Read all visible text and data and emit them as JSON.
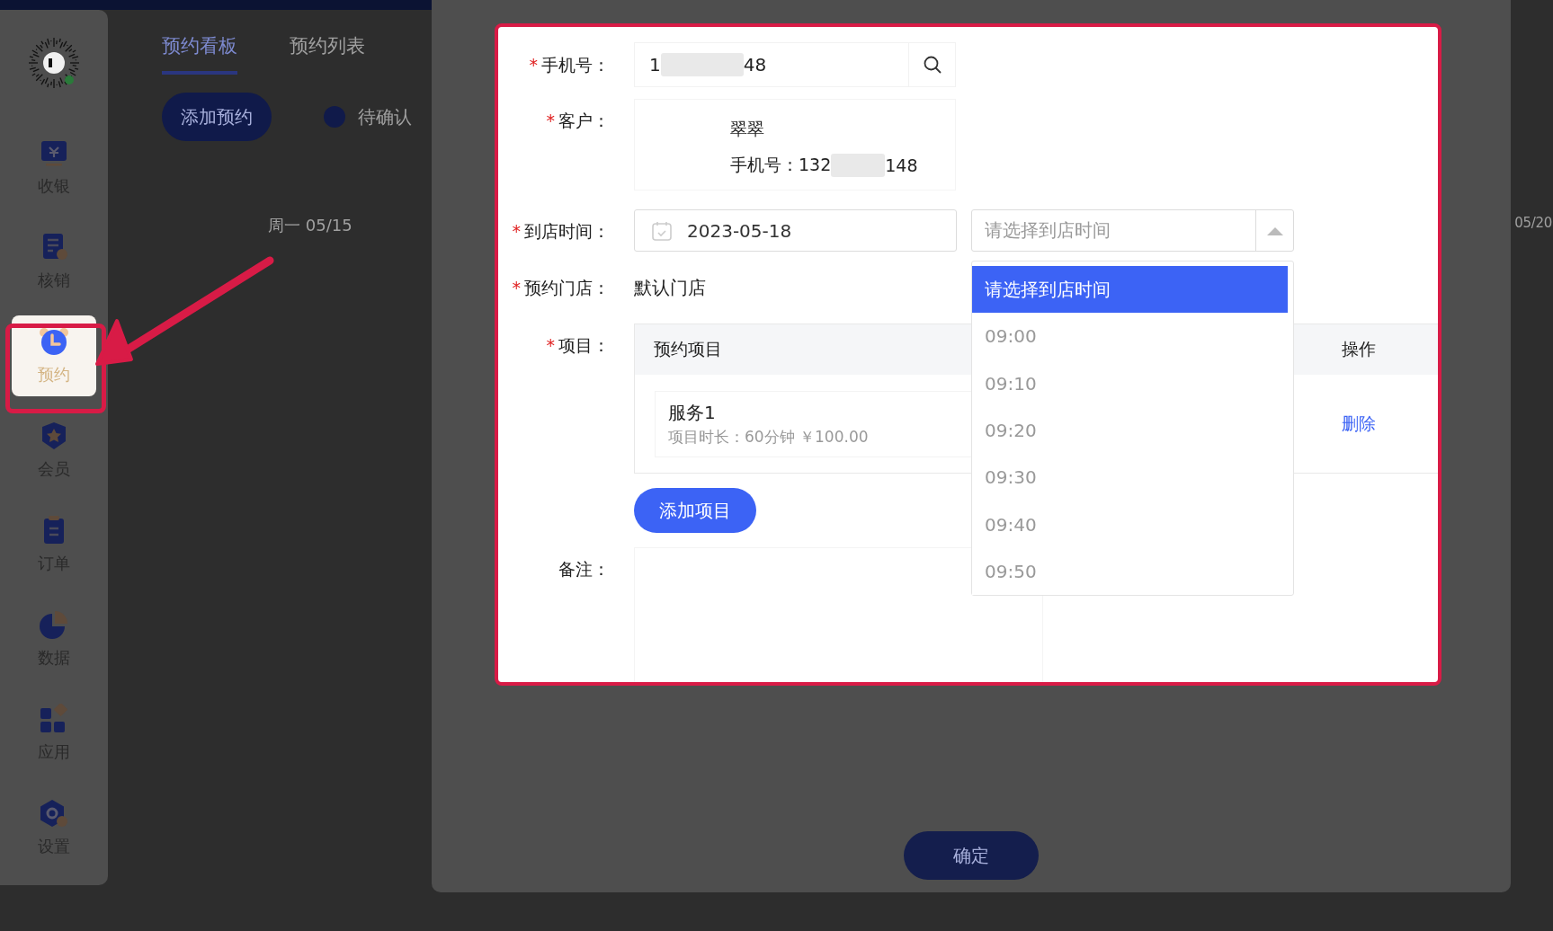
{
  "sidebar": {
    "items": [
      {
        "label": "收银",
        "kind": "cashier",
        "selected": false
      },
      {
        "label": "核销",
        "kind": "verify",
        "selected": false
      },
      {
        "label": "预约",
        "kind": "booking",
        "selected": true
      },
      {
        "label": "会员",
        "kind": "member",
        "selected": false
      },
      {
        "label": "订单",
        "kind": "order",
        "selected": false
      },
      {
        "label": "数据",
        "kind": "data",
        "selected": false
      },
      {
        "label": "应用",
        "kind": "apps",
        "selected": false
      },
      {
        "label": "设置",
        "kind": "settings",
        "selected": false
      }
    ]
  },
  "tabs": [
    {
      "label": "预约看板",
      "selected": true
    },
    {
      "label": "预约列表",
      "selected": false
    }
  ],
  "toolbar": {
    "add_button": "添加预约",
    "legend": [
      {
        "label": "待确认",
        "color": "#101a4a"
      }
    ]
  },
  "calendar": {
    "days": [
      "周一 05/15",
      "05/20"
    ]
  },
  "form": {
    "phone": {
      "label": "手机号：",
      "required_mark": "*",
      "value_start": "1",
      "value_end": "48"
    },
    "customer": {
      "label": "客户：",
      "required_mark": "*",
      "name": "翠翠",
      "phone_label": "手机号：",
      "phone_start": "132",
      "phone_end": "148"
    },
    "arrival": {
      "label": "到店时间：",
      "required_mark": "*",
      "date": "2023-05-18",
      "time_placeholder": "请选择到店时间",
      "expanded": true
    },
    "store": {
      "label": "预约门店：",
      "required_mark": "*",
      "value": "默认门店"
    },
    "items": {
      "label": "项目：",
      "required_mark": "*",
      "columns": [
        "预约项目",
        "操作"
      ],
      "rows": [
        {
          "name": "服务1",
          "detail": "项目时长：60分钟 ￥100.00",
          "action": "删除"
        }
      ],
      "add_button": "添加项目"
    },
    "note": {
      "label": "备注："
    }
  },
  "time_dropdown": {
    "options": [
      {
        "label": "请选择到店时间",
        "selected": true
      },
      {
        "label": "09:00",
        "selected": false
      },
      {
        "label": "09:10",
        "selected": false
      },
      {
        "label": "09:20",
        "selected": false
      },
      {
        "label": "09:30",
        "selected": false
      },
      {
        "label": "09:40",
        "selected": false
      },
      {
        "label": "09:50",
        "selected": false
      }
    ]
  },
  "confirm_button": "确定"
}
